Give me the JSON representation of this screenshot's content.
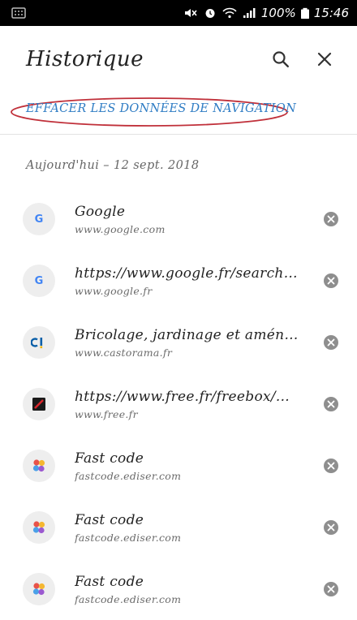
{
  "status_bar": {
    "battery_percent_text": "100%",
    "time": "15:46",
    "icons": [
      "gallery-icon",
      "mute-icon",
      "alarm-icon",
      "wifi-icon",
      "signal-icon",
      "battery-icon"
    ]
  },
  "toolbar": {
    "title": "Historique",
    "search_icon": "search-icon",
    "close_icon": "close-icon"
  },
  "clear_data_label": "EFFACER LES DONNÉES DE NAVIGATION",
  "highlight_color": "#c0303a",
  "link_color": "#2e7cc4",
  "date_header": "Aujourd'hui – 12 sept. 2018",
  "history": [
    {
      "title": "Google",
      "url": "www.google.com",
      "icon": "google-favicon-icon"
    },
    {
      "title": "https://www.google.fr/search?...",
      "url": "www.google.fr",
      "icon": "google-favicon-icon"
    },
    {
      "title": "Bricolage, jardinage et aména...",
      "url": "www.castorama.fr",
      "icon": "castorama-favicon-icon"
    },
    {
      "title": "https://www.free.fr/freebox/...",
      "url": "www.free.fr",
      "icon": "free-favicon-icon"
    },
    {
      "title": "Fast code",
      "url": "fastcode.ediser.com",
      "icon": "fastcode-favicon-icon"
    },
    {
      "title": "Fast code",
      "url": "fastcode.ediser.com",
      "icon": "fastcode-favicon-icon"
    },
    {
      "title": "Fast code",
      "url": "fastcode.ediser.com",
      "icon": "fastcode-favicon-icon"
    }
  ]
}
